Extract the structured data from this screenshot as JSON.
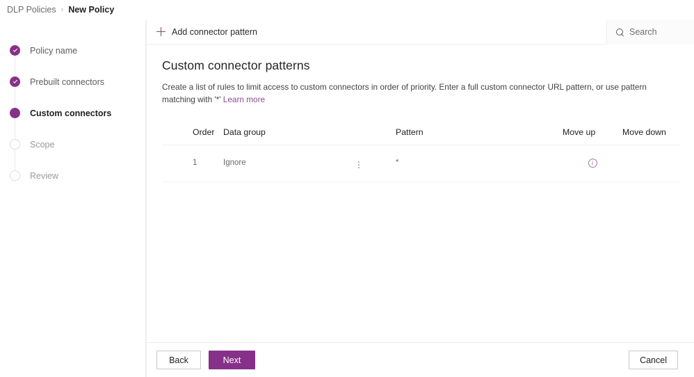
{
  "breadcrumb": {
    "root": "DLP Policies",
    "separator": "›",
    "current": "New Policy"
  },
  "wizard": {
    "steps": [
      {
        "label": "Policy name",
        "state": "done"
      },
      {
        "label": "Prebuilt connectors",
        "state": "done"
      },
      {
        "label": "Custom connectors",
        "state": "current"
      },
      {
        "label": "Scope",
        "state": "pending"
      },
      {
        "label": "Review",
        "state": "pending"
      }
    ]
  },
  "commandbar": {
    "add_label": "Add connector pattern"
  },
  "search": {
    "placeholder": "Search",
    "value": ""
  },
  "main": {
    "title": "Custom connector patterns",
    "description": "Create a list of rules to limit access to custom connectors in order of priority. Enter a full custom connector URL pattern, or use pattern matching with '*' ",
    "learn_more": "Learn more"
  },
  "table": {
    "columns": [
      "Order",
      "Data group",
      "Pattern",
      "Move up",
      "Move down"
    ],
    "rows": [
      {
        "order": "1",
        "data_group": "Ignore",
        "pattern": "*",
        "info": "i",
        "move_up": "",
        "move_down": ""
      }
    ]
  },
  "footer": {
    "back": "Back",
    "next": "Next",
    "cancel": "Cancel"
  },
  "colors": {
    "accent": "#87308a",
    "link": "#8c4a8f",
    "text": "#242424",
    "muted": "#6a6a6a"
  }
}
